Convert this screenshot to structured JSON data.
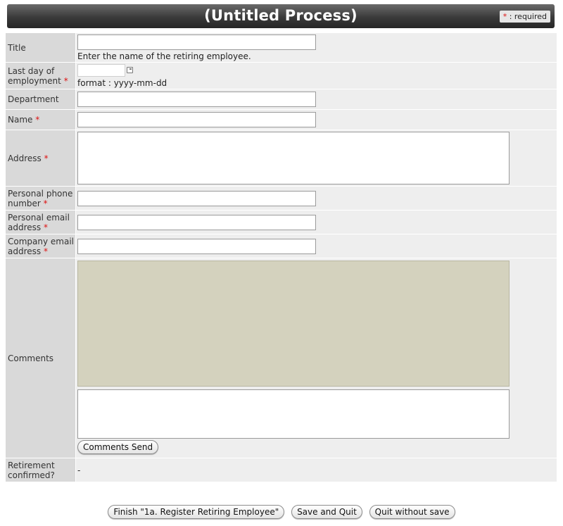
{
  "header": {
    "title": "(Untitled Process)",
    "required_star": "*",
    "required_text": ": required"
  },
  "fields": {
    "title": {
      "label": "Title",
      "value": "",
      "hint": "Enter the name of the retiring employee."
    },
    "last_day": {
      "label_line1": "Last day of",
      "label_line2": "employment",
      "star": "*",
      "value": "",
      "hint": "format : yyyy-mm-dd"
    },
    "department": {
      "label": "Department",
      "value": ""
    },
    "name": {
      "label": "Name",
      "star": "*",
      "value": ""
    },
    "address": {
      "label": "Address",
      "star": "*",
      "value": ""
    },
    "personal_phone": {
      "label_line1": "Personal phone",
      "label_line2": "number",
      "star": "*",
      "value": ""
    },
    "personal_email": {
      "label_line1": "Personal email",
      "label_line2": "address",
      "star": "*",
      "value": ""
    },
    "company_email": {
      "label_line1": "Company email",
      "label_line2": "address",
      "star": "*",
      "value": ""
    },
    "comments": {
      "label": "Comments",
      "input_value": "",
      "send_label": "Comments Send"
    },
    "retirement": {
      "label_line1": "Retirement",
      "label_line2": "confirmed?",
      "value": "-"
    }
  },
  "actions": {
    "finish_label": "Finish \"1a. Register Retiring Employee\"",
    "save_quit_label": "Save and Quit",
    "quit_nosave_label": "Quit without save"
  }
}
